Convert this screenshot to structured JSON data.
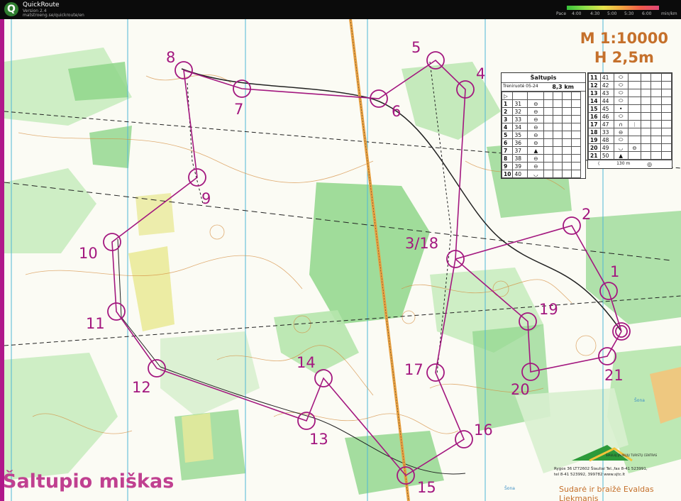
{
  "app": {
    "name": "QuickRoute",
    "version": "Version 2.4",
    "website": "matstroeng.se/quickroute/en",
    "logo_letter": "Q"
  },
  "pace_legend": {
    "label": "Pace",
    "ticks": [
      "4:00",
      "4:30",
      "5:00",
      "5:30",
      "6:00"
    ],
    "unit": "min/km"
  },
  "map": {
    "scale": "M 1:10000",
    "contour": "H 2,5m",
    "title": "Šaltupio miškas",
    "water_label_1": "Šona",
    "water_label_2": "Šona",
    "club_name": "ŠIAULIŲ JAUNŲJŲ TURISTŲ CENTRAS",
    "club_address_1": "Rygos 36  LT72602  Šiauliai   Tel.,fax  8-41 523991,",
    "club_address_2": "tel 8-41 523992, 399782  www.sjtc.lt",
    "credit": "Sudarė ir braižė Evaldas Liekmanis",
    "colors": {
      "course": "#a3177f",
      "frame": "#b0188a",
      "forest": "#8fd68a",
      "credit": "#c5702b"
    }
  },
  "controls": [
    {
      "label": "1"
    },
    {
      "label": "2"
    },
    {
      "label": "3/18"
    },
    {
      "label": "4"
    },
    {
      "label": "5"
    },
    {
      "label": "6"
    },
    {
      "label": "7"
    },
    {
      "label": "8"
    },
    {
      "label": "9"
    },
    {
      "label": "10"
    },
    {
      "label": "11"
    },
    {
      "label": "12"
    },
    {
      "label": "13"
    },
    {
      "label": "14"
    },
    {
      "label": "15"
    },
    {
      "label": "16"
    },
    {
      "label": "17"
    },
    {
      "label": "19"
    },
    {
      "label": "20"
    },
    {
      "label": "21"
    }
  ],
  "description_sheet": {
    "title": "Šaltupis",
    "event": "Treniruotė 05-24",
    "length": "8,3 km",
    "finish_distance": "130 m",
    "rows_left": [
      {
        "n": "1",
        "code": "31",
        "sym": "⊖"
      },
      {
        "n": "2",
        "code": "32",
        "sym": "⊖"
      },
      {
        "n": "3",
        "code": "33",
        "sym": "⊖"
      },
      {
        "n": "4",
        "code": "34",
        "sym": "⊖"
      },
      {
        "n": "5",
        "code": "35",
        "sym": "⊖"
      },
      {
        "n": "6",
        "code": "36",
        "sym": "⊖"
      },
      {
        "n": "7",
        "code": "37",
        "sym": "▲"
      },
      {
        "n": "8",
        "code": "38",
        "sym": "⊖"
      },
      {
        "n": "9",
        "code": "39",
        "sym": "⊖"
      },
      {
        "n": "10",
        "code": "40",
        "sym": "◡"
      }
    ],
    "rows_right": [
      {
        "n": "11",
        "code": "41",
        "sym": "⬭",
        "extra": ""
      },
      {
        "n": "12",
        "code": "42",
        "sym": "⬭",
        "extra": ""
      },
      {
        "n": "13",
        "code": "43",
        "sym": "⬭",
        "extra": ""
      },
      {
        "n": "14",
        "code": "44",
        "sym": "⬭",
        "extra": ""
      },
      {
        "n": "15",
        "code": "45",
        "sym": "•",
        "extra": ""
      },
      {
        "n": "16",
        "code": "46",
        "sym": "⬭",
        "extra": ""
      },
      {
        "n": "17",
        "code": "47",
        "sym": "∩",
        "extra": "ᛁ"
      },
      {
        "n": "18",
        "code": "33",
        "sym": "⊖",
        "extra": ""
      },
      {
        "n": "19",
        "code": "48",
        "sym": "⬭",
        "extra": ""
      },
      {
        "n": "20",
        "code": "49",
        "sym": "◡",
        "extra": "⊖"
      },
      {
        "n": "21",
        "code": "50",
        "sym": "▲",
        "extra": ""
      }
    ]
  }
}
